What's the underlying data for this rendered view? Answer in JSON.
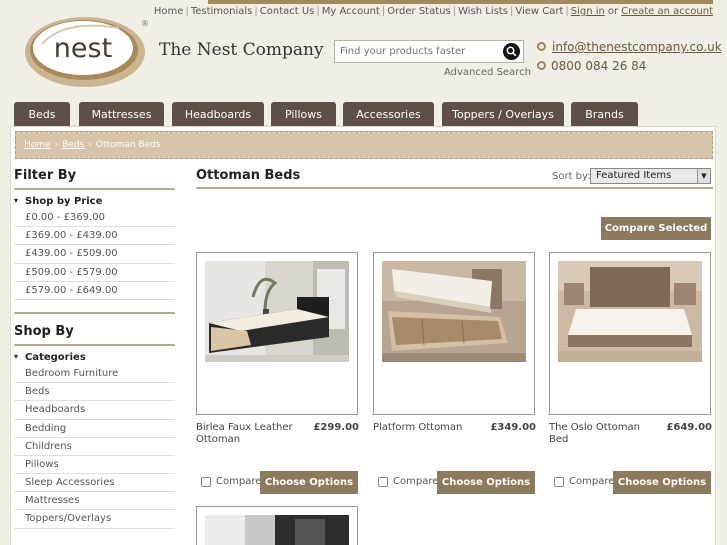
{
  "top_links": {
    "items": [
      "Home",
      "Testimonials",
      "Contact Us",
      "My Account",
      "Order Status",
      "Wish Lists",
      "View Cart"
    ],
    "sign_in": "Sign in",
    "or": "or",
    "create_account": "Create an account"
  },
  "brand": {
    "logo_text": "nest",
    "registered": "®",
    "company_name": "The Nest Company"
  },
  "search": {
    "placeholder": "Find your products faster",
    "advanced": "Advanced Search"
  },
  "contact": {
    "email": "info@thenestcompany.co.uk",
    "phone": "0800 084 26 84"
  },
  "nav": [
    "Beds",
    "Mattresses",
    "Headboards",
    "Pillows",
    "Accessories",
    "Toppers / Overlays",
    "Brands"
  ],
  "breadcrumb": {
    "home": "Home",
    "beds": "Beds",
    "current": "Ottoman Beds",
    "sep": "›"
  },
  "filter": {
    "title": "Filter By",
    "price_heading": "Shop by Price",
    "prices": [
      "£0.00 - £369.00",
      "£369.00 - £439.00",
      "£439.00 - £509.00",
      "£509.00 - £579.00",
      "£579.00 - £649.00"
    ]
  },
  "shop_by": {
    "title": "Shop By",
    "categories_heading": "Categories",
    "categories": [
      "Bedroom Furniture",
      "Beds",
      "Headboards",
      "Bedding",
      "Childrens",
      "Pillows",
      "Sleep Accessories",
      "Mattresses",
      "Toppers/Overlays"
    ]
  },
  "listing": {
    "title": "Ottoman Beds",
    "sort_label": "Sort by:",
    "sort_value": "Featured Items",
    "compare_selected": "Compare Selected",
    "compare_label": "Compare",
    "choose_options": "Choose Options"
  },
  "products": [
    {
      "name": "Birlea Faux Leather Ottoman",
      "price": "£299.00"
    },
    {
      "name": "Platform Ottoman",
      "price": "£349.00"
    },
    {
      "name": "The Oslo Ottoman Bed",
      "price": "£649.00"
    }
  ],
  "colors": {
    "nav_bg": "#5e5048",
    "accent_brown": "#8b7a5d",
    "breadcrumb_bg": "#d7c4ab",
    "link": "#6b5a3c"
  }
}
